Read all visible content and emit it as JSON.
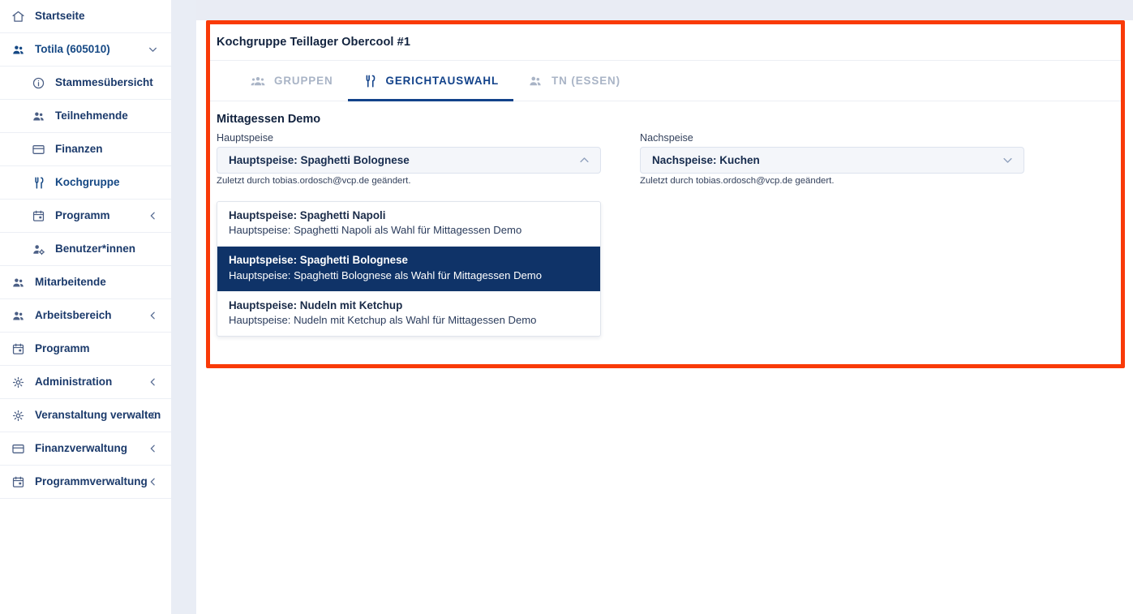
{
  "sidebar": {
    "items": [
      {
        "label": "Startseite",
        "icon": "home-icon",
        "level": 0,
        "chevron": "",
        "active": false
      },
      {
        "label": "Totila (605010)",
        "icon": "users-icon",
        "level": 0,
        "chevron": "down",
        "active": true
      },
      {
        "label": "Stammesübersicht",
        "icon": "info-icon",
        "level": 1,
        "chevron": "",
        "active": false
      },
      {
        "label": "Teilnehmende",
        "icon": "users-icon",
        "level": 1,
        "chevron": "",
        "active": false
      },
      {
        "label": "Finanzen",
        "icon": "card-icon",
        "level": 1,
        "chevron": "",
        "active": false
      },
      {
        "label": "Kochgruppe",
        "icon": "cutlery-icon",
        "level": 1,
        "chevron": "",
        "active": true
      },
      {
        "label": "Programm",
        "icon": "calendar-icon",
        "level": 1,
        "chevron": "left",
        "active": false
      },
      {
        "label": "Benutzer*innen",
        "icon": "user-gear-icon",
        "level": 1,
        "chevron": "",
        "active": false
      },
      {
        "label": "Mitarbeitende",
        "icon": "users-icon",
        "level": 0,
        "chevron": "",
        "active": false
      },
      {
        "label": "Arbeitsbereich",
        "icon": "users-icon",
        "level": 0,
        "chevron": "left",
        "active": false
      },
      {
        "label": "Programm",
        "icon": "calendar-icon",
        "level": 0,
        "chevron": "",
        "active": false
      },
      {
        "label": "Administration",
        "icon": "gear-icon",
        "level": 0,
        "chevron": "left",
        "active": false
      },
      {
        "label": "Veranstaltung verwalten",
        "icon": "gear-icon",
        "level": 0,
        "chevron": "left",
        "active": false
      },
      {
        "label": "Finanzverwaltung",
        "icon": "card-icon",
        "level": 0,
        "chevron": "left",
        "active": false
      },
      {
        "label": "Programmverwaltung",
        "icon": "calendar-icon",
        "level": 0,
        "chevron": "left",
        "active": false
      }
    ]
  },
  "card": {
    "title": "Kochgruppe Teillager Obercool #1",
    "highlight_color": "#f93a08",
    "tabs": [
      {
        "label": "GRUPPEN",
        "icon": "group-people-icon",
        "selected": false
      },
      {
        "label": "GERICHTAUSWAHL",
        "icon": "cutlery-icon",
        "selected": true
      },
      {
        "label": "TN (ESSEN)",
        "icon": "people-icon",
        "selected": false
      }
    ]
  },
  "meal": {
    "section_title": "Mittagessen Demo",
    "accent_color": "#0f3368",
    "courses": [
      {
        "label": "Hauptspeise",
        "value": "Hauptspeise: Spaghetti Bolognese",
        "hint": "Zuletzt durch tobias.ordosch@vcp.de geändert.",
        "expanded": true,
        "caret": "up",
        "options": [
          {
            "title": "Hauptspeise: Spaghetti Napoli",
            "desc": "Hauptspeise: Spaghetti Napoli als Wahl für Mittagessen Demo",
            "selected": false
          },
          {
            "title": "Hauptspeise: Spaghetti Bolognese",
            "desc": "Hauptspeise: Spaghetti Bolognese als Wahl für Mittagessen Demo",
            "selected": true
          },
          {
            "title": "Hauptspeise: Nudeln mit Ketchup",
            "desc": "Hauptspeise: Nudeln mit Ketchup als Wahl für Mittagessen Demo",
            "selected": false
          }
        ]
      },
      {
        "label": "Nachspeise",
        "value": "Nachspeise: Kuchen",
        "hint": "Zuletzt durch tobias.ordosch@vcp.de geändert.",
        "expanded": false,
        "caret": "down",
        "options": []
      }
    ]
  }
}
